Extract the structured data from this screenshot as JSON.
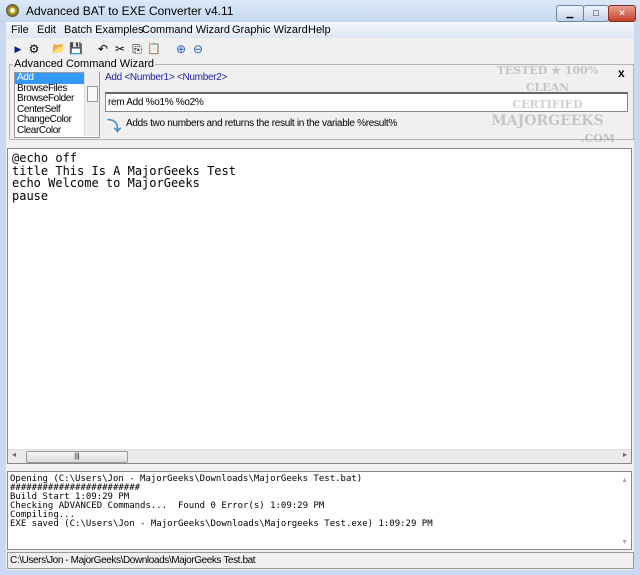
{
  "window": {
    "title": "Advanced BAT to EXE Converter v4.11",
    "minimize": "▁",
    "maximize": "□",
    "close": "✕"
  },
  "menu": [
    "File",
    "Edit",
    "Batch Examples",
    "Command Wizard",
    "Graphic Wizard",
    "Help"
  ],
  "toolbar": [
    {
      "icon": "run-icon",
      "glyph": "▶"
    },
    {
      "icon": "compile-icon",
      "glyph": "⚙"
    },
    {
      "icon": "open-folder-icon",
      "glyph": "📂"
    },
    {
      "icon": "save-icon",
      "glyph": "💾"
    },
    {
      "icon": "undo-icon",
      "glyph": "↶"
    },
    {
      "icon": "cut-icon",
      "glyph": "✂"
    },
    {
      "icon": "copy-icon",
      "glyph": "⎘"
    },
    {
      "icon": "paste-icon",
      "glyph": "📋"
    },
    {
      "icon": "zoom-in-icon",
      "glyph": "⊕"
    },
    {
      "icon": "zoom-out-icon",
      "glyph": "⊖"
    }
  ],
  "wizard": {
    "label": "Advanced Command Wizard",
    "commands": [
      "Add",
      "BrowseFiles",
      "BrowseFolder",
      "CenterSelf",
      "ChangeColor",
      "ClearColor"
    ],
    "selected": "Add",
    "syntax": "Add  <Number1> <Number2>",
    "input": "rem Add %o1% %o2%",
    "description": "Adds two numbers and returns the result in the variable %result%",
    "close": "x"
  },
  "watermark": {
    "line1": "TESTED ★ 100% CLEAN",
    "line2": "CERTIFIED",
    "line3": "MAJORGEEKS",
    "line4": ".COM"
  },
  "editor": {
    "code": "@echo off\ntitle This Is A MajorGeeks Test\necho Welcome to MajorGeeks\npause"
  },
  "log": {
    "text": "Opening (C:\\Users\\Jon - MajorGeeks\\Downloads\\MajorGeeks Test.bat)\n########################\nBuild Start 1:09:29 PM\nChecking ADVANCED Commands...  Found 0 Error(s) 1:09:29 PM\nCompiling...\nEXE saved (C:\\Users\\Jon - MajorGeeks\\Downloads\\Majorgeeks Test.exe) 1:09:29 PM"
  },
  "status": "C:\\Users\\Jon - MajorGeeks\\Downloads\\MajorGeeks Test.bat"
}
